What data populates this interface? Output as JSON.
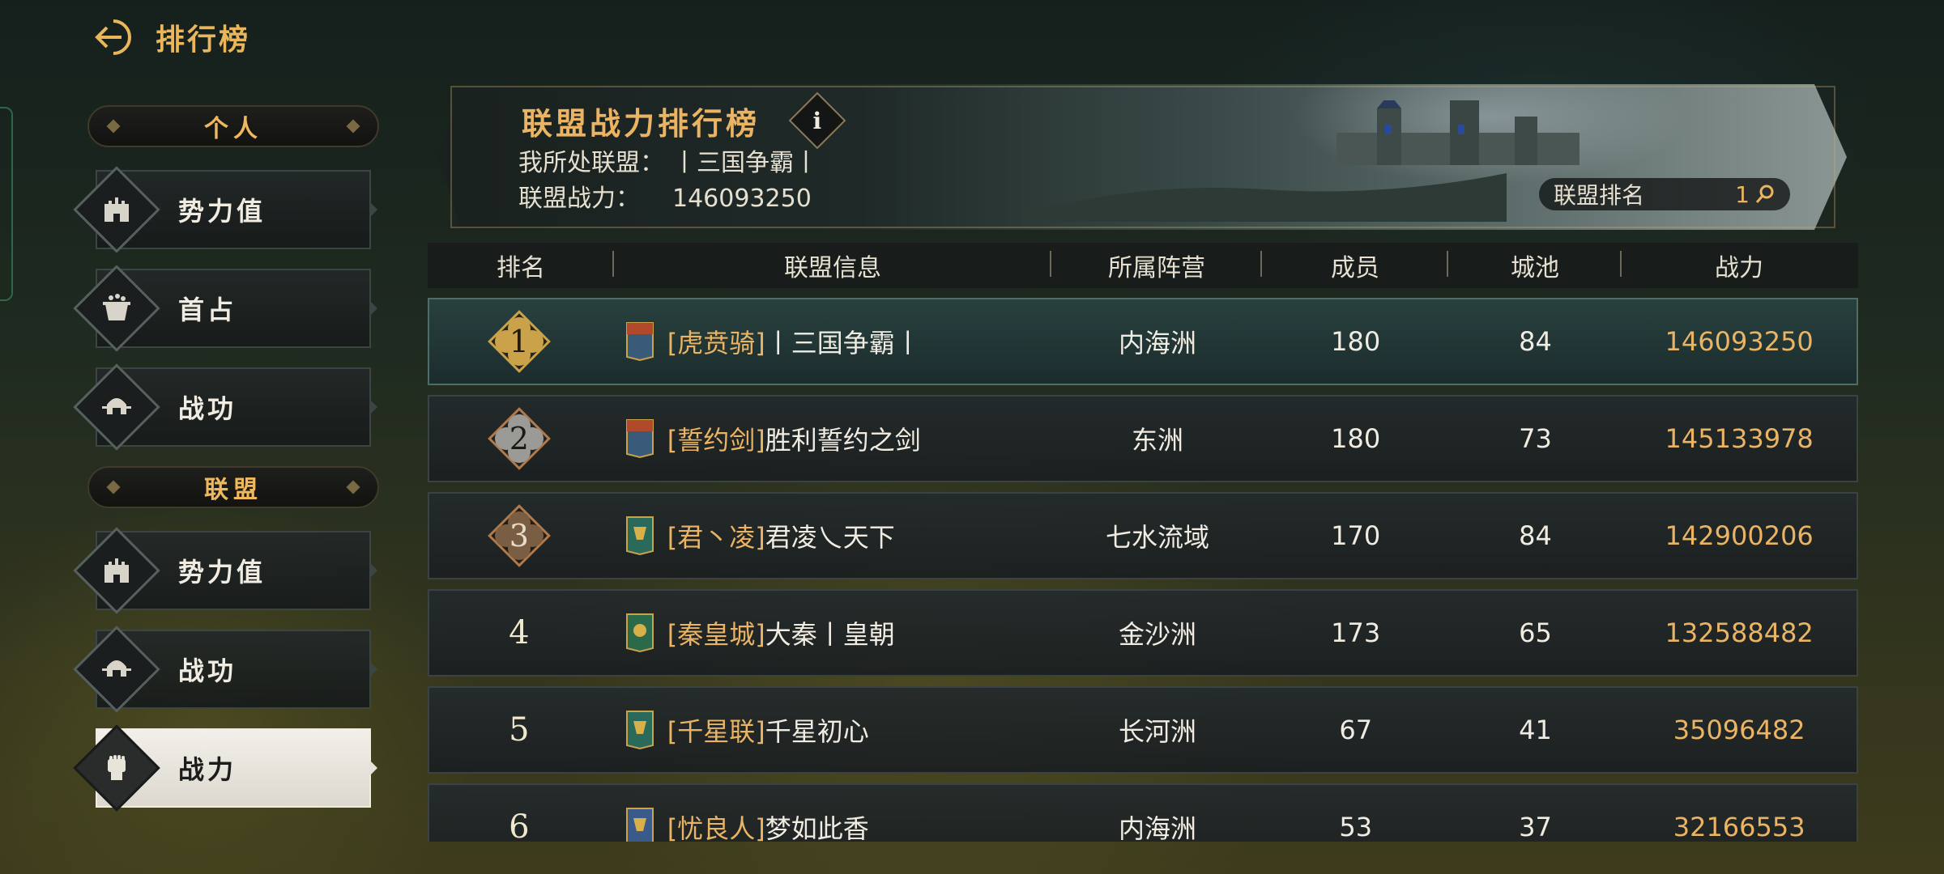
{
  "header": {
    "title": "排行榜"
  },
  "sidebar": {
    "personal_label": "个人",
    "personal_items": [
      {
        "label": "势力值",
        "icon": "castle-icon"
      },
      {
        "label": "首占",
        "icon": "cauldron-icon"
      },
      {
        "label": "战功",
        "icon": "helmet-icon"
      }
    ],
    "alliance_label": "联盟",
    "alliance_items": [
      {
        "label": "势力值",
        "icon": "castle-icon"
      },
      {
        "label": "战功",
        "icon": "helmet-icon"
      },
      {
        "label": "战力",
        "icon": "fist-icon",
        "active": true
      }
    ]
  },
  "banner": {
    "title": "联盟战力排行榜",
    "info": "i",
    "my_alliance_label": "我所处联盟：",
    "my_alliance_value": "丨三国争霸丨",
    "my_power_label": "联盟战力：",
    "my_power_value": "146093250",
    "rank_label": "联盟排名",
    "rank_value": "1"
  },
  "table": {
    "columns": [
      "排名",
      "联盟信息",
      "所属阵营",
      "成员",
      "城池",
      "战力"
    ],
    "rows": [
      {
        "rank": "1",
        "tag": "[虎贲骑]",
        "name": "丨三国争霸丨",
        "camp": "内海洲",
        "members": "180",
        "cities": "84",
        "power": "146093250"
      },
      {
        "rank": "2",
        "tag": "[誓约剑]",
        "name": "胜利誓约之剑",
        "camp": "东洲",
        "members": "180",
        "cities": "73",
        "power": "145133978"
      },
      {
        "rank": "3",
        "tag": "[君丶凌]",
        "name": "君凌乀天下",
        "camp": "七水流域",
        "members": "170",
        "cities": "84",
        "power": "142900206"
      },
      {
        "rank": "4",
        "tag": "[秦皇城]",
        "name": "大秦丨皇朝",
        "camp": "金沙洲",
        "members": "173",
        "cities": "65",
        "power": "132588482"
      },
      {
        "rank": "5",
        "tag": "[千星联]",
        "name": "千星初心",
        "camp": "长河洲",
        "members": "67",
        "cities": "41",
        "power": "35096482"
      },
      {
        "rank": "6",
        "tag": "[忧良人]",
        "name": "梦如此香",
        "camp": "内海洲",
        "members": "53",
        "cities": "37",
        "power": "32166553"
      }
    ]
  },
  "colors": {
    "accent_gold": "#eab464",
    "gold_badge": "#c9a24a",
    "silver_badge": "#9a9a96",
    "bronze_badge": "#7a5e44"
  }
}
